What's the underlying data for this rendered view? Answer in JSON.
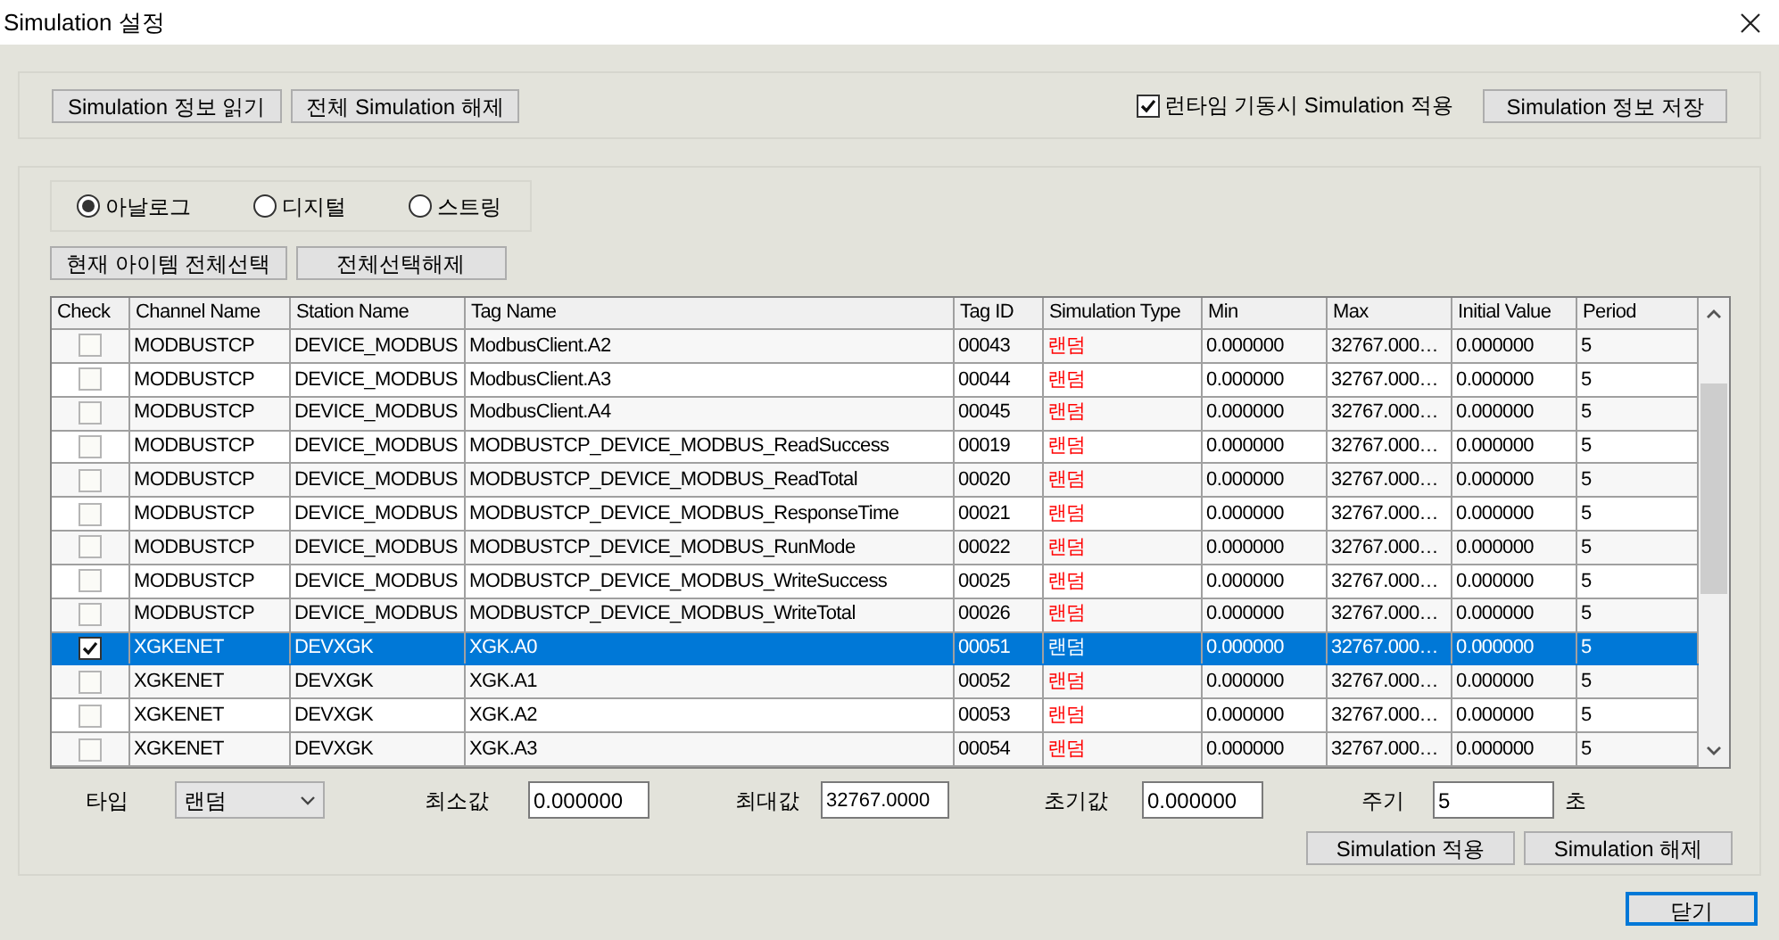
{
  "window": {
    "title": "Simulation 설정"
  },
  "top_buttons": [
    "Simulation 정보 읽기",
    "전체 Simulation 해제"
  ],
  "runtime_option": {
    "label": "런타임 기동시 Simulation 적용",
    "checked": true
  },
  "save_button": "Simulation 정보 저장",
  "radios": [
    {
      "label": "아날로그",
      "selected": true
    },
    {
      "label": "디지털",
      "selected": false
    },
    {
      "label": "스트링",
      "selected": false
    }
  ],
  "select_buttons": [
    "현재 아이템 전체선택",
    "전체선택해제"
  ],
  "table": {
    "columns": [
      "Check",
      "Channel Name",
      "Station Name",
      "Tag Name",
      "Tag ID",
      "Simulation Type",
      "Min",
      "Max",
      "Initial Value",
      "Period"
    ],
    "rows": [
      {
        "checked": false,
        "selected": false,
        "cells": [
          "",
          "MODBUSTCP",
          "DEVICE_MODBUS",
          "ModbusClient.A2",
          "00043",
          "랜덤",
          "0.000000",
          "32767.000…",
          "0.000000",
          "5"
        ]
      },
      {
        "checked": false,
        "selected": false,
        "cells": [
          "",
          "MODBUSTCP",
          "DEVICE_MODBUS",
          "ModbusClient.A3",
          "00044",
          "랜덤",
          "0.000000",
          "32767.000…",
          "0.000000",
          "5"
        ]
      },
      {
        "checked": false,
        "selected": false,
        "cells": [
          "",
          "MODBUSTCP",
          "DEVICE_MODBUS",
          "ModbusClient.A4",
          "00045",
          "랜덤",
          "0.000000",
          "32767.000…",
          "0.000000",
          "5"
        ]
      },
      {
        "checked": false,
        "selected": false,
        "cells": [
          "",
          "MODBUSTCP",
          "DEVICE_MODBUS",
          "MODBUSTCP_DEVICE_MODBUS_ReadSuccess",
          "00019",
          "랜덤",
          "0.000000",
          "32767.000…",
          "0.000000",
          "5"
        ]
      },
      {
        "checked": false,
        "selected": false,
        "cells": [
          "",
          "MODBUSTCP",
          "DEVICE_MODBUS",
          "MODBUSTCP_DEVICE_MODBUS_ReadTotal",
          "00020",
          "랜덤",
          "0.000000",
          "32767.000…",
          "0.000000",
          "5"
        ]
      },
      {
        "checked": false,
        "selected": false,
        "cells": [
          "",
          "MODBUSTCP",
          "DEVICE_MODBUS",
          "MODBUSTCP_DEVICE_MODBUS_ResponseTime",
          "00021",
          "랜덤",
          "0.000000",
          "32767.000…",
          "0.000000",
          "5"
        ]
      },
      {
        "checked": false,
        "selected": false,
        "cells": [
          "",
          "MODBUSTCP",
          "DEVICE_MODBUS",
          "MODBUSTCP_DEVICE_MODBUS_RunMode",
          "00022",
          "랜덤",
          "0.000000",
          "32767.000…",
          "0.000000",
          "5"
        ]
      },
      {
        "checked": false,
        "selected": false,
        "cells": [
          "",
          "MODBUSTCP",
          "DEVICE_MODBUS",
          "MODBUSTCP_DEVICE_MODBUS_WriteSuccess",
          "00025",
          "랜덤",
          "0.000000",
          "32767.000…",
          "0.000000",
          "5"
        ]
      },
      {
        "checked": false,
        "selected": false,
        "cells": [
          "",
          "MODBUSTCP",
          "DEVICE_MODBUS",
          "MODBUSTCP_DEVICE_MODBUS_WriteTotal",
          "00026",
          "랜덤",
          "0.000000",
          "32767.000…",
          "0.000000",
          "5"
        ]
      },
      {
        "checked": true,
        "selected": true,
        "cells": [
          "",
          "XGKENET",
          "DEVXGK",
          "XGK.A0",
          "00051",
          "랜덤",
          "0.000000",
          "32767.000…",
          "0.000000",
          "5"
        ]
      },
      {
        "checked": false,
        "selected": false,
        "cells": [
          "",
          "XGKENET",
          "DEVXGK",
          "XGK.A1",
          "00052",
          "랜덤",
          "0.000000",
          "32767.000…",
          "0.000000",
          "5"
        ]
      },
      {
        "checked": false,
        "selected": false,
        "cells": [
          "",
          "XGKENET",
          "DEVXGK",
          "XGK.A2",
          "00053",
          "랜덤",
          "0.000000",
          "32767.000…",
          "0.000000",
          "5"
        ]
      },
      {
        "checked": false,
        "selected": false,
        "cells": [
          "",
          "XGKENET",
          "DEVXGK",
          "XGK.A3",
          "00054",
          "랜덤",
          "0.000000",
          "32767.000…",
          "0.000000",
          "5"
        ]
      }
    ]
  },
  "editor": {
    "fields": [
      {
        "kind": "select",
        "label": "타입",
        "value": "랜덤"
      },
      {
        "kind": "input",
        "label": "최소값",
        "value": "0.000000"
      },
      {
        "kind": "input",
        "label": "최대값",
        "value": "32767.0000"
      },
      {
        "kind": "input",
        "label": "초기값",
        "value": "0.000000"
      },
      {
        "kind": "input",
        "label": "주기",
        "value": "5",
        "unit": "초"
      }
    ],
    "buttons": [
      "Simulation 적용",
      "Simulation 해제"
    ]
  },
  "close_button": "닫기"
}
